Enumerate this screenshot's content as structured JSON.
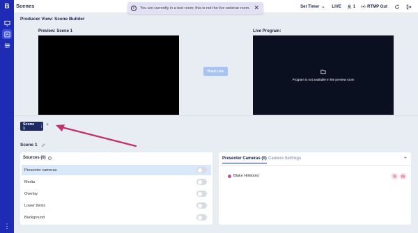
{
  "app": {
    "logo": "B",
    "page_title": "Scenes"
  },
  "rail": {
    "icons": [
      "monitor-icon",
      "scenes-icon",
      "settings-sliders-icon"
    ],
    "more": "⋮"
  },
  "toast": {
    "message": "You are currently in a test room; this is not the live webinar room."
  },
  "topbar": {
    "set_timer": "Set Timer",
    "live": "LIVE",
    "viewer_count": "1",
    "rtmp": "RTMP Out"
  },
  "builder": {
    "title": "Producer View: Scene Builder",
    "preview_label": "Preview: Scene 1",
    "program_label": "Live Program:",
    "program_message": "Program is not available in the preview room",
    "push_live": "Push Live"
  },
  "scenes": {
    "tabs": [
      {
        "label": "Scene 1",
        "badge": "⋮"
      }
    ],
    "add": "+"
  },
  "scene_name": "Scene 1",
  "sources": {
    "header": "Sources (0)",
    "items": [
      {
        "label": "Presenter cameras"
      },
      {
        "label": "Media"
      },
      {
        "label": "Overlay"
      },
      {
        "label": "Lower thirds"
      },
      {
        "label": "Background"
      }
    ]
  },
  "presenters": {
    "tabs": [
      "Presenter Cameras (0)",
      "Camera Settings"
    ],
    "add": "+",
    "people": [
      {
        "name": "Blake Hillebold"
      }
    ]
  },
  "colors": {
    "rail": "#1e2bb5",
    "active_tab": "#1e2a63",
    "push_live": "#a8c3f0",
    "arrow": "#c0306a"
  }
}
